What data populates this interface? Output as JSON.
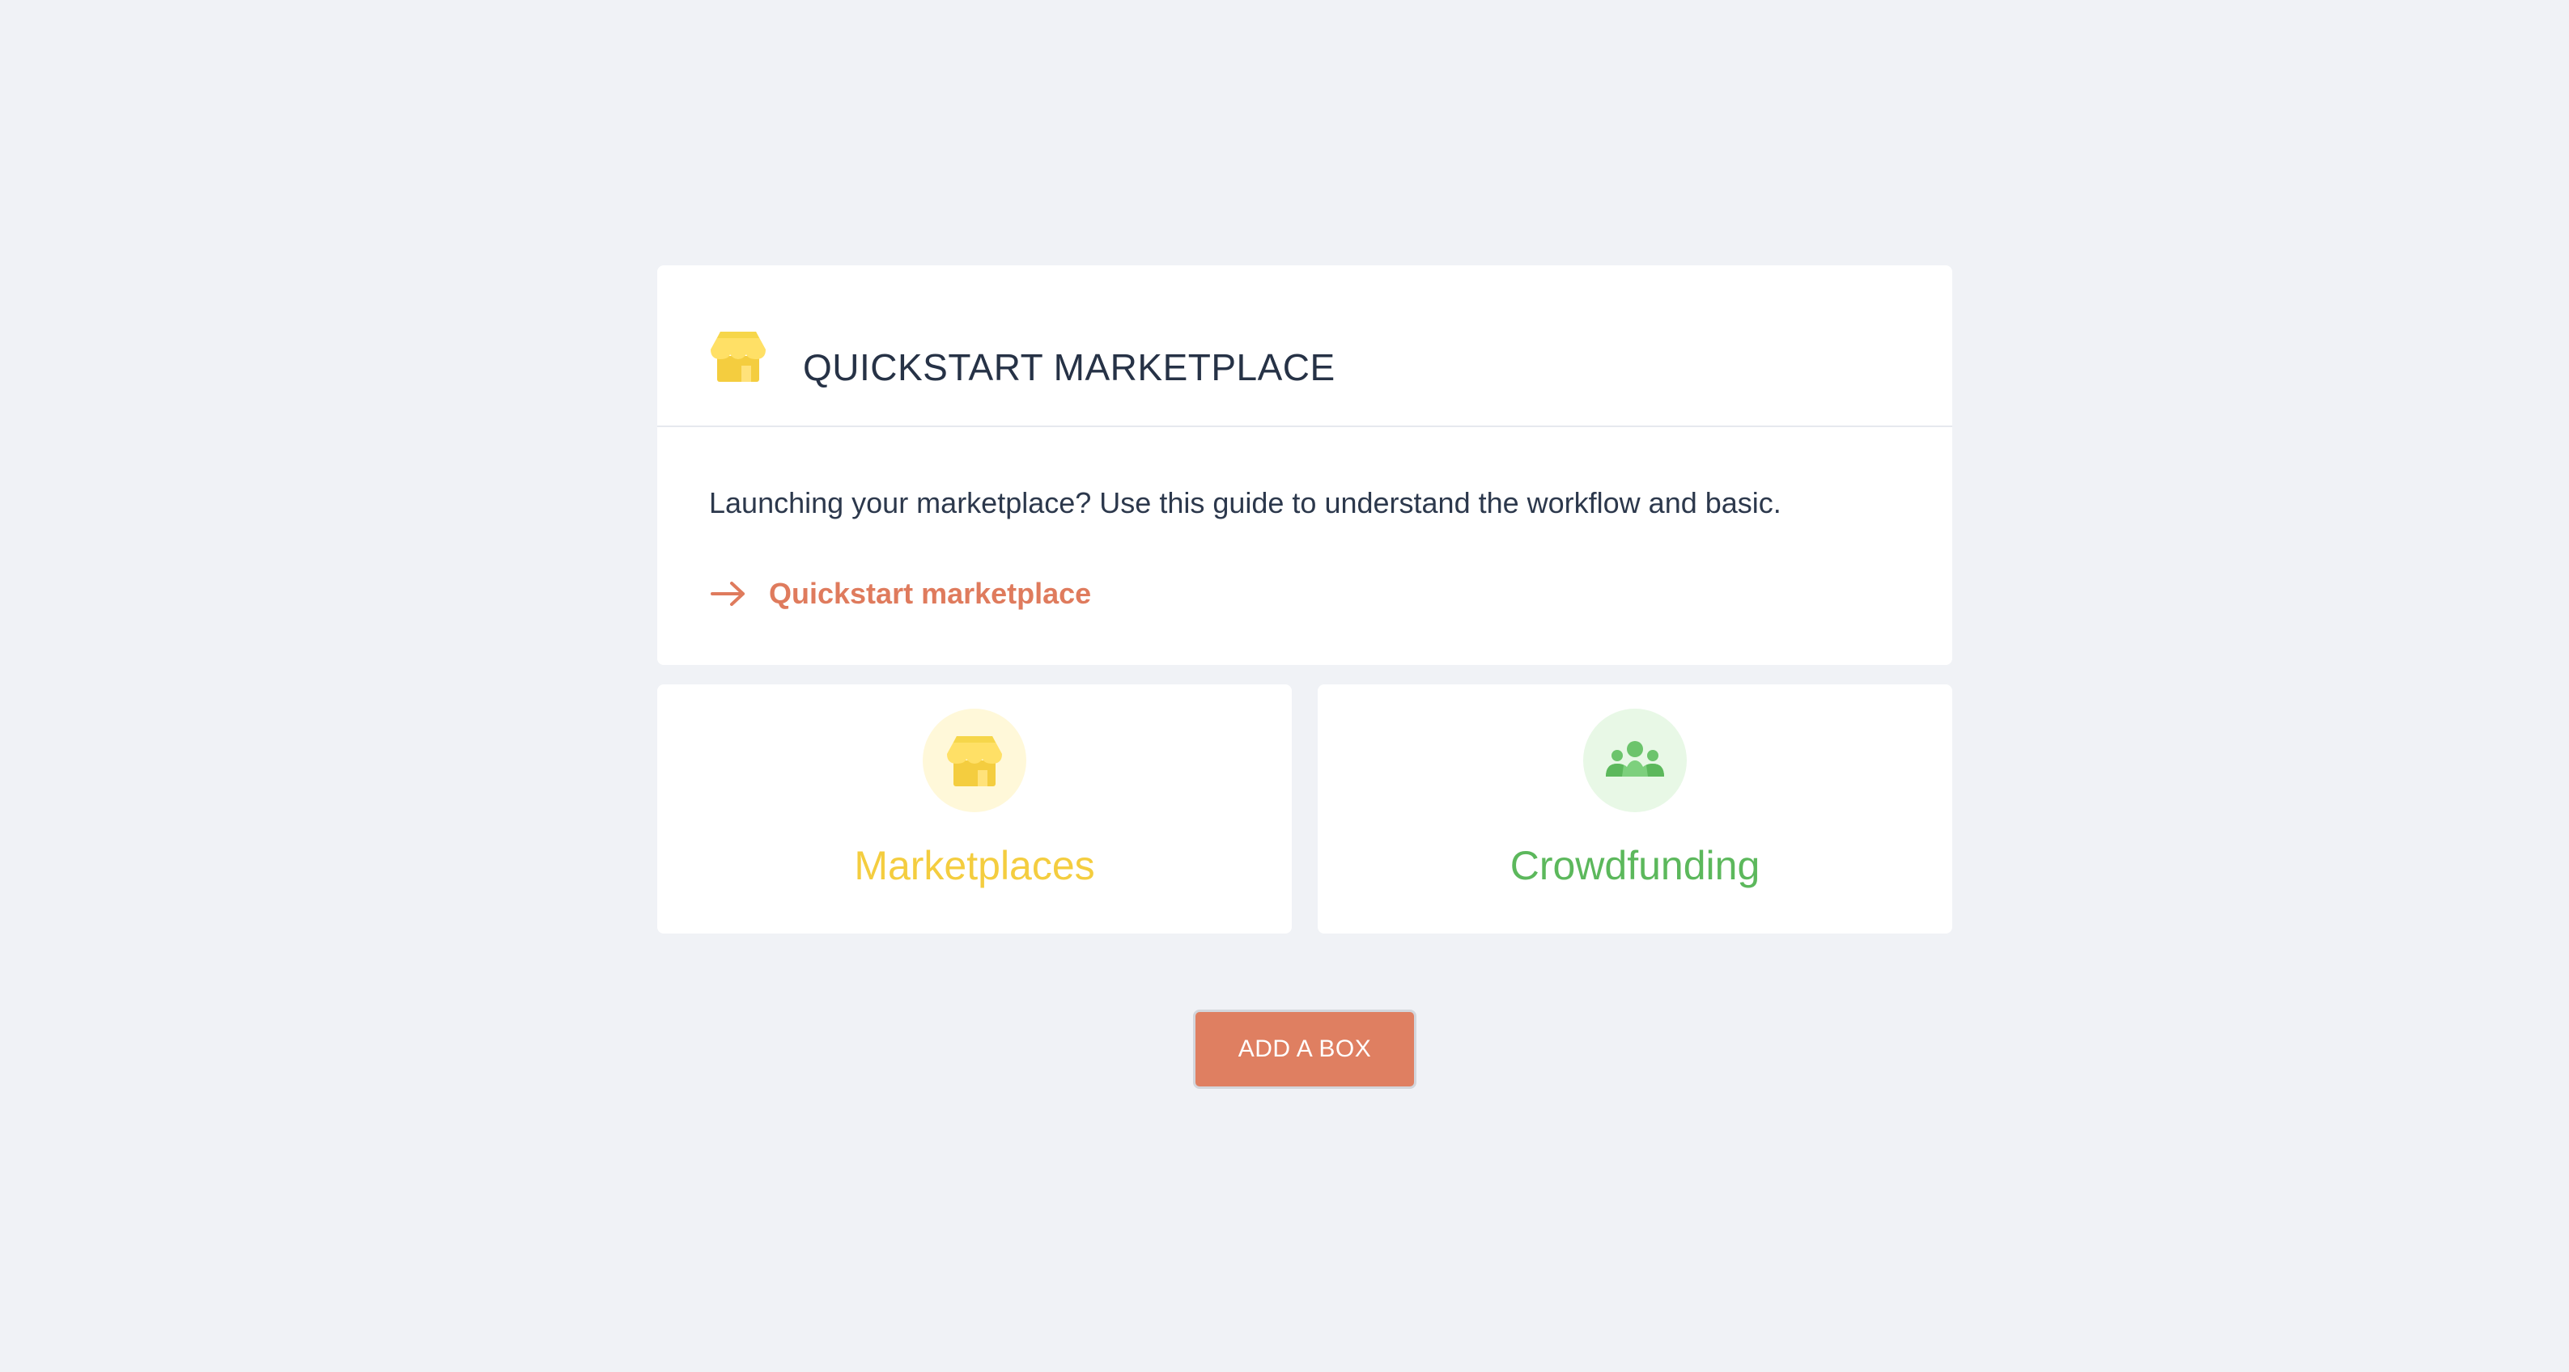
{
  "colors": {
    "background": "#f0f2f6",
    "accent": "#df7b5d",
    "marketplaces": "#f4cd3f",
    "crowdfunding": "#5cb85c"
  },
  "main_card": {
    "icon": "shop-icon",
    "title": "QUICKSTART MARKETPLACE",
    "description": "Launching your marketplace? Use this guide to understand the workflow and basic.",
    "link": {
      "icon": "arrow-right-icon",
      "label": "Quickstart marketplace"
    }
  },
  "tiles": [
    {
      "icon": "shop-icon",
      "label": "Marketplaces"
    },
    {
      "icon": "group-icon",
      "label": "Crowdfunding"
    }
  ],
  "add_button": {
    "label": "ADD A BOX"
  }
}
